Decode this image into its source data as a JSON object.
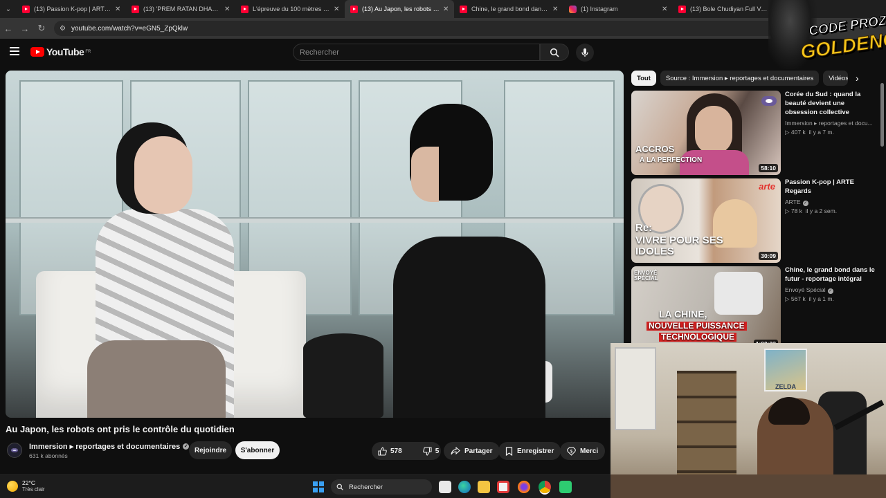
{
  "browser": {
    "tabs": [
      {
        "title": "(13) Passion K-pop | ARTE Rega",
        "favicon": "youtube-icon",
        "active": false
      },
      {
        "title": "(13) 'PREM RATAN DHAN PAYO",
        "favicon": "youtube-icon",
        "active": false
      },
      {
        "title": "L'épreuve du 100 mètres | Doc",
        "favicon": "youtube-icon",
        "active": false
      },
      {
        "title": "(13) Au Japon, les robots ont p",
        "favicon": "youtube-icon",
        "active": true
      },
      {
        "title": "Chine, le grand bond dans le fu",
        "favicon": "youtube-icon",
        "active": false
      },
      {
        "title": "(1) Instagram",
        "favicon": "instagram-icon",
        "active": false
      },
      {
        "title": "(13) Bole Chudiyan Full Video",
        "favicon": "youtube-icon",
        "active": false
      }
    ],
    "url": "youtube.com/watch?v=eGN5_ZpQklw"
  },
  "youtube": {
    "logo_text": "YouTube",
    "region": "FR",
    "search_placeholder": "Rechercher"
  },
  "video": {
    "title": "Au Japon, les robots ont pris le contrôle du quotidien",
    "channel": "Immersion ▸ reportages et documentaires",
    "subscribers": "631 k abonnés",
    "join_label": "Rejoindre",
    "subscribe_label": "S'abonner",
    "likes": "578",
    "dislikes": "5",
    "share_label": "Partager",
    "save_label": "Enregistrer",
    "thanks_label": "Merci"
  },
  "sidebar": {
    "chips": [
      "Tout",
      "Source : Immersion ▸ reportages et documentaires",
      "Vidéos"
    ],
    "recommendations": [
      {
        "title": "Corée du Sud : quand la beauté devient une obsession collective",
        "channel": "Immersion ▸ reportages et docu...",
        "views": "▷ 407 k",
        "age": "il y a 7 m.",
        "duration": "58:10",
        "overlay_line1": "ACCROS",
        "overlay_line2": "À LA PERFECTION"
      },
      {
        "title": "Passion K-pop | ARTE Regards",
        "channel": "ARTE",
        "views": "▷ 78 k",
        "age": "il y a 2 sem.",
        "duration": "30:09",
        "overlay_line1": "Re:",
        "overlay_line2": "VIVRE POUR SES IDOLES",
        "brand": "arte"
      },
      {
        "title": "Chine, le grand bond dans le futur - reportage intégral",
        "channel": "Envoyé Spécial",
        "views": "▷ 567 k",
        "age": "il y a 1 m.",
        "duration": "1:00:23",
        "overlay_line1": "LA CHINE,",
        "overlay_line2": "NOUVELLE PUISSANCE",
        "overlay_line3": "TECHNOLOGIQUE",
        "brand": "ENVOYÉ SPÉCIAL"
      }
    ]
  },
  "stream_overlay": {
    "line1": "CODE PROZIS",
    "line2": "GOLDENG"
  },
  "webcam": {
    "poster_text": "ZELDA"
  },
  "taskbar": {
    "temperature": "22°C",
    "condition": "Très clair",
    "search_label": "Rechercher"
  }
}
